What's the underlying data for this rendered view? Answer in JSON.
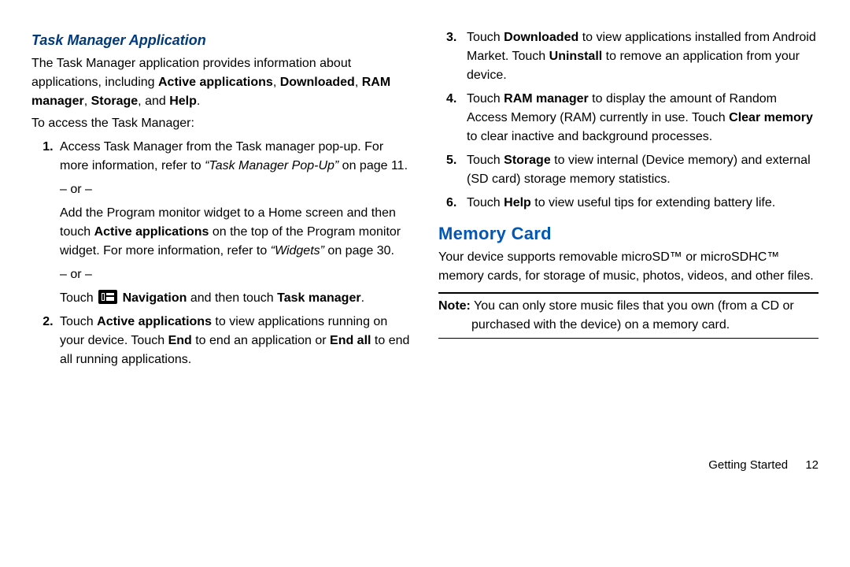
{
  "left": {
    "h3": "Task Manager Application",
    "intro": {
      "pre": "The Task Manager application provides information about applications, including ",
      "b1": "Active applications",
      "sep1": ", ",
      "b2": "Downloaded",
      "sep2": ", ",
      "b3": "RAM manager",
      "sep3": ", ",
      "b4": "Storage",
      "sep4": ", and ",
      "b5": "Help",
      "post": "."
    },
    "access_line": "To access the Task Manager:",
    "li1_part1": "Access Task Manager from the Task manager pop-up. For more information, refer to ",
    "li1_em": "“Task Manager Pop-Up”",
    "li1_part2": " on page 11.",
    "or": "– or –",
    "li1b_pre": "Add the Program monitor widget to a Home screen and then touch ",
    "li1b_b": "Active applications",
    "li1b_mid": " on the top of the Program monitor widget. For more information, refer to ",
    "li1b_em": "“Widgets” ",
    "li1b_post": " on page 30.",
    "li1c_pre": "Touch ",
    "li1c_b1": "Navigation",
    "li1c_mid": " and then touch ",
    "li1c_b2": "Task manager",
    "li1c_post": ".",
    "li2_pre": "Touch ",
    "li2_b1": "Active applications",
    "li2_mid1": " to view applications running on your device. Touch ",
    "li2_b2": "End",
    "li2_mid2": " to end an application or ",
    "li2_b3": "End all",
    "li2_post": " to end all running applications."
  },
  "right": {
    "li3_pre": "Touch ",
    "li3_b1": "Downloaded",
    "li3_mid": " to view applications installed from Android Market. Touch ",
    "li3_b2": "Uninstall",
    "li3_post": " to remove an application from your device.",
    "li4_pre": "Touch ",
    "li4_b1": "RAM manager",
    "li4_mid": " to display the amount of Random Access Memory (RAM) currently in use. Touch ",
    "li4_b2": "Clear memory",
    "li4_post": " to clear inactive and background processes.",
    "li5_pre": "Touch ",
    "li5_b1": "Storage",
    "li5_post": " to view internal (Device memory) and external (SD card) storage memory statistics.",
    "li6_pre": "Touch ",
    "li6_b1": "Help",
    "li6_post": " to view useful tips for extending battery life.",
    "h2": "Memory Card",
    "mc_intro": "Your device supports removable microSD™ or microSDHC™ memory cards, for storage of music, photos, videos, and other files.",
    "note_label": "Note:",
    "note_text": " You can only store music files that you own (from a CD or purchased with the device) on a memory card."
  },
  "footer": {
    "chapter": "Getting Started",
    "page": "12"
  }
}
